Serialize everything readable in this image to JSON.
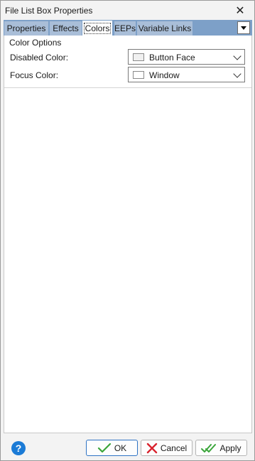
{
  "window": {
    "title": "File List Box Properties"
  },
  "tabs": [
    {
      "label": "Properties",
      "active": false
    },
    {
      "label": "Effects",
      "active": false
    },
    {
      "label": "Colors",
      "active": true
    },
    {
      "label": "EEPs",
      "active": false
    },
    {
      "label": "Variable Links",
      "active": false
    }
  ],
  "colors_tab": {
    "group_title": "Color Options",
    "disabled_color": {
      "label": "Disabled Color:",
      "value": "Button Face",
      "swatch": "#f0f0f0"
    },
    "focus_color": {
      "label": "Focus Color:",
      "value": "Window",
      "swatch": "#ffffff"
    }
  },
  "footer": {
    "help_icon": "?",
    "ok_label": "OK",
    "cancel_label": "Cancel",
    "apply_label": "Apply"
  },
  "icons": {
    "close": "close-icon",
    "help": "help-icon",
    "ok": "checkmark-icon",
    "cancel": "x-mark-icon",
    "apply": "double-checkmark-icon"
  },
  "accent_colors": {
    "tabstrip": "#7da0c8",
    "help": "#1b7bd6",
    "ok_check": "#3aa53a",
    "cancel_x": "#d9232e"
  }
}
